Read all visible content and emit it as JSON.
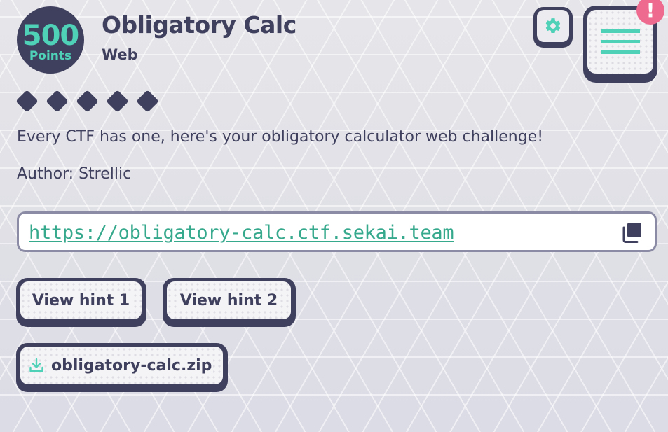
{
  "challenge": {
    "points": "500",
    "points_label": "Points",
    "title": "Obligatory Calc",
    "category": "Web",
    "difficulty_count": 5,
    "description": "Every CTF has one, here's your obligatory calculator web challenge!",
    "author": "Author: Strellic",
    "url": "https://obligatory-calc.ctf.sekai.team"
  },
  "buttons": {
    "hint1": "View hint 1",
    "hint2": "View hint 2",
    "file": "obligatory-calc.zip"
  },
  "alert": {
    "symbol": "!"
  },
  "icons": {
    "settings": "gear-icon",
    "menu": "menu-icon",
    "copy": "copy-icon",
    "download": "download-icon",
    "difficulty": "diamond-icon"
  },
  "colors": {
    "primary": "#3f3f5e",
    "accent": "#4fd1b8",
    "link": "#36a98d",
    "alert": "#ee6b8f",
    "border": "#8b8ba5"
  }
}
